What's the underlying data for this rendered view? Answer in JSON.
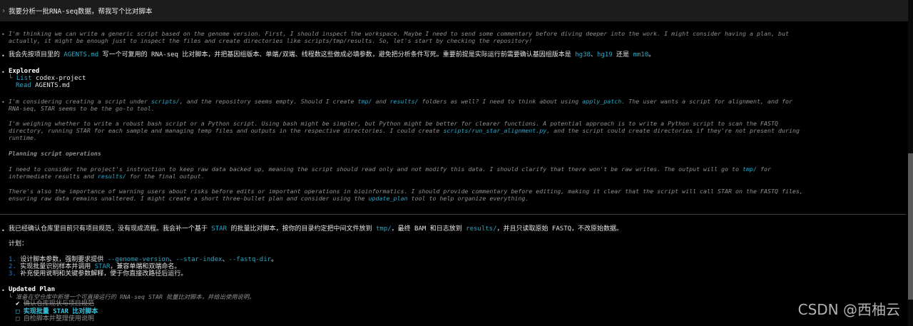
{
  "prompt": {
    "chevron": "›",
    "text": "我要分析一批RNA-seq数据，帮我写个比对脚本"
  },
  "thinking1": {
    "line1": "I'm thinking we can write a generic script based on the genome version. First, I should inspect the workspace. Maybe I need to send some commentary before diving deeper into the work. I might consider having a plan, but",
    "line2": "actually, it might be enough just to inspect the files and create directories like scripts/tmp/results. So, let's start by checking the repository!"
  },
  "message1": {
    "p1": "我会先按项目里的 ",
    "code1": "AGENTS.md",
    "p2": " 写一个可复用的 RNA-seq 比对脚本，并把基因组版本、单端/双端、线程数这些做成必填参数，避免把分析条件写死。重要前提是实际运行前需要确认基因组版本是 ",
    "code2": "hg38",
    "p3": "、",
    "code3": "hg19",
    "p4": " 还是 ",
    "code4": "mm10",
    "p5": "。"
  },
  "explored": {
    "title": "Explored",
    "branch": "└",
    "item1_verb": "List",
    "item1_target": "codex-project",
    "item2_verb": "Read",
    "item2_target": "AGENTS.md"
  },
  "thinking2": {
    "a1": "I'm considering creating a script under ",
    "a_code1": "scripts/",
    "a2": ", and the repository seems empty. Should I create ",
    "a_code2": "tmp/",
    "a3": " and ",
    "a_code3": "results/",
    "a4": " folders as well? I need to think about using ",
    "a_code4": "apply_patch",
    "a5": ". The user wants a script for alignment, and for",
    "a_line2": "RNA-seq, STAR seems to be the go-to tool.",
    "b_line1": "I'm weighing whether to write a robust bash script or a Python script. Using bash might be simpler, but Python might be better for clearer functions. A potential approach is to write a Python script to scan the FASTQ",
    "b2_1": "directory, running STAR for each sample and managing temp files and outputs in the respective directories. I could create ",
    "b2_code": "scripts/run_star_alignment.py",
    "b2_2": ", and the script could create directories if they're not present during",
    "b_line3": "runtime.",
    "heading": "Planning script operations",
    "c1": "I need to consider the project's instruction to keep raw data backed up, meaning the script should read only and not modify this data. I should clarify that there won't be raw writes. The output will go to ",
    "c_code1": "tmp/",
    "c2": " for",
    "c3": "intermediate results and ",
    "c_code2": "results/",
    "c4": " for the final output.",
    "d_line1": "There's also the importance of warning users about risks before edits or important operations in bioinformatics. I should provide commentary before editing, making it clear that the script will call STAR on the FASTQ files,",
    "d2_1": "ensuring raw data remains unaltered. I might create a short three-bullet plan and consider using the ",
    "d2_code": "update_plan",
    "d2_2": " tool to help organize everything."
  },
  "message2": {
    "p1": "我已经确认仓库里目前只有项目规范，没有现成流程。我会补一个基于 ",
    "code1": "STAR",
    "p2": " 的批量比对脚本，按你的目录约定把中间文件放到 ",
    "code2": "tmp/",
    "p3": "，最终 BAM 和日志放到 ",
    "code3": "results/",
    "p4": "，并且只读取原始 FASTQ，不改原始数据。",
    "plan_label": "计划：",
    "step1_num": "1.",
    "step1_a": " 设计脚本参数，强制要求提供 ",
    "step1_code1": "--genome-version",
    "step1_sep1": "、",
    "step1_code2": "--star-index",
    "step1_sep2": "、",
    "step1_code3": "--fastq-dir",
    "step1_end": "。",
    "step2_num": "2.",
    "step2_a": " 实现批量识别样本并调用 ",
    "step2_code": "STAR",
    "step2_b": "，兼容单端和双端命名。",
    "step3_num": "3.",
    "step3_a": " 补充使用说明和关键参数解释，便于你直接改路径后运行。"
  },
  "updated_plan": {
    "title": "Updated Plan",
    "branch": "└",
    "subtitle": "准备在空仓库中新增一个可直接运行的 RNA-seq STAR 批量比对脚本，并给出使用说明。",
    "item1_mark": "✔",
    "item1_text": "确认仓库现状与项目规范",
    "item2_mark": "□",
    "item2_text": "实现批量 STAR 比对脚本",
    "item3_mark": "□",
    "item3_text": "自检脚本并整理使用说明"
  },
  "watermark": "CSDN @西柚云"
}
